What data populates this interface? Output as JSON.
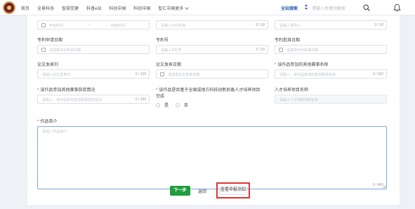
{
  "nav": {
    "items": [
      "首页",
      "全景科协",
      "智慧党建",
      "科普e站",
      "科创中国",
      "科创中国",
      "智汇中国更多"
    ],
    "search_scope": "全站搜索",
    "search_placeholder": "请输入关键词搜索"
  },
  "form": {
    "row1": {
      "range_start": "开始时间",
      "range_sep": "-",
      "range_end": "结束时间",
      "mid_placeholder": "请输入专利名称",
      "mid_count": "0 / 30",
      "right_placeholder": "请输入发明人",
      "right_count": "0 / 30"
    },
    "patent_apply_date": {
      "label": "专利申请日期",
      "placeholder": "请选择专利申请日期"
    },
    "patent_no": {
      "label": "专利号",
      "placeholder": "请输入专利号",
      "count": "0 / 30"
    },
    "patent_grant_date": {
      "label": "专利批准日期",
      "placeholder": "请选择专利批准日期"
    },
    "paper_journal": {
      "label": "论文发表刊",
      "placeholder": "请输入论文发表刊",
      "count": "0 / 100"
    },
    "paper_date": {
      "label": "论文发表日期",
      "placeholder": "请选择论文发表日期"
    },
    "competition_name": {
      "label": "该作品参加的其他赛事名称",
      "required": "*",
      "placeholder": "请输入，该作品参加的其他赛事名称",
      "count": "0 / 100"
    },
    "competition_award": {
      "label": "该作品参加其他赛事获奖情况",
      "required": "*",
      "placeholder": "请输入，该作品参加其他赛事获奖情况",
      "count": "0 / 100"
    },
    "based_on_program": {
      "label_line1": "该作品是否基于全国或地方科技创新后备人才培养项目",
      "label_line2": "完成",
      "required": "*",
      "option_yes": "是",
      "option_no": "否"
    },
    "program_name": {
      "label": "人才培养项目名称",
      "placeholder": "请输入人才培养项目名称"
    },
    "intro": {
      "label": "作品简介",
      "required": "*",
      "placeholder": "请输入作品简介",
      "count": "0 / 400"
    }
  },
  "actions": {
    "next": "下一步",
    "back": "返回",
    "notice": "查看申报须知"
  },
  "colors": {
    "primary_green": "#1f9d3f",
    "highlight_red": "#e03333",
    "scope_blue": "#2b5fb3"
  }
}
